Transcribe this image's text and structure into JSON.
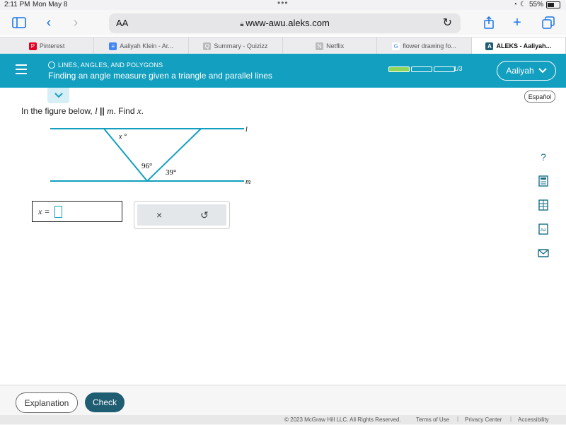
{
  "statusbar": {
    "time": "2:11 PM",
    "date": "Mon May 8",
    "battery": "55%"
  },
  "browser": {
    "aa_label": "AA",
    "url": "www-awu.aleks.com",
    "tabs": [
      {
        "label": "Pinterest",
        "fav_color": "#e60023",
        "fav_glyph": "P"
      },
      {
        "label": "Aaliyah Klein - Ar...",
        "fav_color": "#4285f4",
        "fav_glyph": "≡"
      },
      {
        "label": "Summary - Quizizz",
        "fav_color": "#bbbbbb",
        "fav_glyph": "Q"
      },
      {
        "label": "Netflix",
        "fav_color": "#bbbbbb",
        "fav_glyph": "N"
      },
      {
        "label": "flower drawing fo...",
        "fav_color": "#ffffff",
        "fav_glyph": "G"
      },
      {
        "label": "ALEKS - Aaliyah...",
        "fav_color": "#1f5d72",
        "fav_glyph": "A"
      }
    ]
  },
  "header": {
    "topic": "LINES, ANGLES, AND POLYGONS",
    "title": "Finding an angle measure given a triangle and parallel lines",
    "progress_done": 1,
    "progress_total": 3,
    "progress_label": "1/3",
    "user": "Aaliyah"
  },
  "espanol": "Español",
  "prompt": {
    "text_before": "In the figure below, ",
    "l": "l",
    "parallel": "||",
    "m": "m",
    "text_after": ". Find ",
    "x": "x",
    "end": "."
  },
  "figure": {
    "angle_x": "x °",
    "angle_96": "96°",
    "angle_39": "39°",
    "line_l": "l",
    "line_m": "m"
  },
  "answer": {
    "label": "x =",
    "value": ""
  },
  "tools": {
    "clear": "×",
    "undo": "↺"
  },
  "side_tools": [
    "help-icon",
    "calculator-icon",
    "data-icon",
    "dictionary-icon",
    "message-icon"
  ],
  "buttons": {
    "explanation": "Explanation",
    "check": "Check"
  },
  "footer": {
    "copyright": "© 2023 McGraw Hill LLC. All Rights Reserved.",
    "terms": "Terms of Use",
    "privacy": "Privacy Center",
    "accessibility": "Accessibility"
  },
  "colors": {
    "accent": "#139fc0",
    "check": "#1f5d72",
    "progress": "#8dd65a"
  }
}
